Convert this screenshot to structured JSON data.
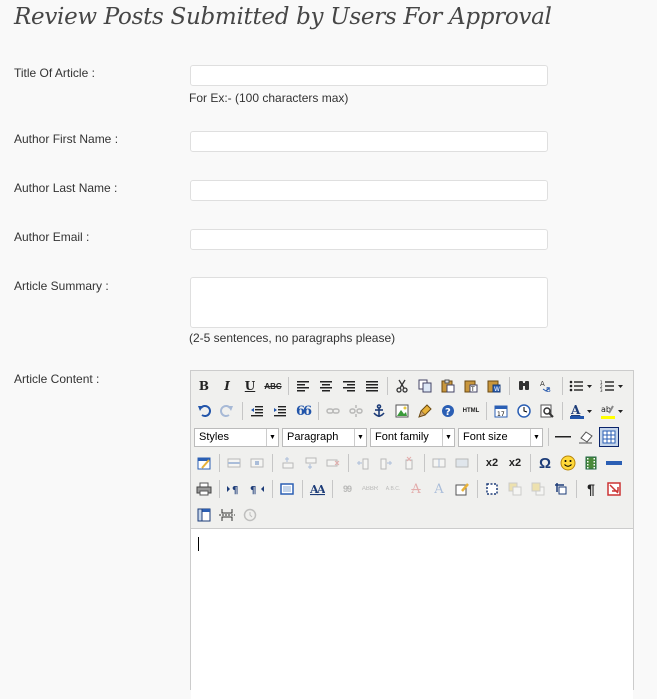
{
  "page": {
    "title": "Review Posts Submitted by Users For Approval"
  },
  "form": {
    "title_label": "Title Of Article :",
    "title_value": "",
    "title_hint": "For Ex:- (100 characters max)",
    "first_name_label": "Author First Name :",
    "first_name_value": "",
    "last_name_label": "Author Last Name :",
    "last_name_value": "",
    "email_label": "Author Email :",
    "email_value": "",
    "summary_label": "Article Summary :",
    "summary_value": "",
    "summary_hint": "(2-5 sentences, no paragraphs please)",
    "content_label": "Article Content :"
  },
  "editor": {
    "styles_select": "Styles",
    "format_select": "Paragraph",
    "font_family_select": "Font family",
    "font_size_select": "Font size",
    "glyphs": {
      "bold": "B",
      "italic": "I",
      "underline": "U",
      "strike": "ABC",
      "blockquote": "66",
      "html": "HTML",
      "subscript": "x2",
      "superscript": "x2",
      "charmap": "Ω",
      "font_color": "A",
      "highlight": "ab",
      "pilcrow_ltr": "¶",
      "cite": "99",
      "abbr": "ABBR",
      "acronym": "A.B.C.",
      "a_strike": "A",
      "a_ins": "A"
    },
    "content": ""
  },
  "colors": {
    "accent_blue": "#2255aa",
    "toolbar_bg": "#f0f0ee"
  }
}
